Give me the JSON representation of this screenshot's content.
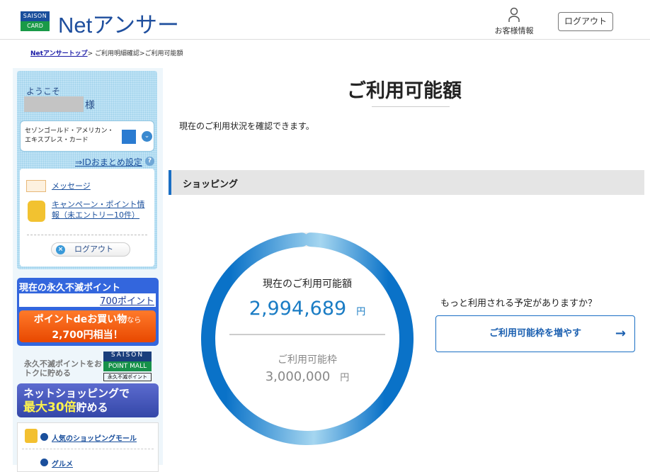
{
  "header": {
    "logo_top": "SAISON",
    "logo_bottom": "CARD",
    "brand": "Netアンサー",
    "customer_info": "お客様情報",
    "logout": "ログアウト"
  },
  "breadcrumb": {
    "home": "Netアンサートップ",
    "trail": "> ご利用明細確認>ご利用可能額"
  },
  "sidebar": {
    "welcome": "ようこそ",
    "honorific": "様",
    "card_name": "セゾンゴールド・アメリカン・エキスプレス・カード",
    "id_setting": "⇒IDおまとめ設定",
    "message": "メッセージ",
    "campaign": "キャンペーン・ポイント情報（未エントリー10件）",
    "logout": "ログアウト",
    "points_title": "現在の永久不滅ポイント",
    "points_value": "700ポイント",
    "shopping_offer_main": "ポイントdeお買い物",
    "shopping_offer_suffix": "なら",
    "shopping_offer_value": "2,700円相当！",
    "mall_text": "永久不滅ポイントをおトクに貯める",
    "mall_logo_top": "SAISON",
    "mall_logo_mid": "POINT MALL",
    "mall_logo_bottom": "永久不滅ポイント",
    "net_line1": "ネットショッピングで",
    "net_line2a": "最大30倍",
    "net_line2b": "貯める",
    "link_mall": "人気のショッピングモール",
    "link_gourmet": "グルメ"
  },
  "main": {
    "title": "ご利用可能額",
    "description": "現在のご利用状況を確認できます。",
    "section": "ショッピング",
    "available_label": "現在のご利用可能額",
    "available_value": "2,994,689",
    "currency": "円",
    "limit_label": "ご利用可能枠",
    "limit_value": "3,000,000",
    "available_fraction": 0.998,
    "question": "もっと利用される予定がありますか？",
    "increase_button": "ご利用可能枠を増やす"
  },
  "colors": {
    "accent": "#1a6fc4",
    "ring_light": "#a5d6f0"
  }
}
